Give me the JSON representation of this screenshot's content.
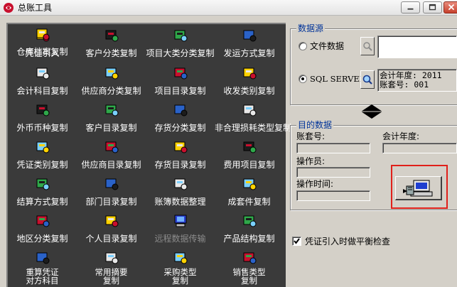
{
  "window": {
    "title": "总账工具"
  },
  "tools": [
    {
      "label": "凭证引入",
      "icon": "voucher-stamp-icon"
    },
    {
      "label": "客户分类复制",
      "icon": "customer-category-icon"
    },
    {
      "label": "项目大类分类复制",
      "icon": "project-class-icon"
    },
    {
      "label": "发运方式复制",
      "icon": "shipping-method-icon"
    },
    {
      "label": "会计科目复制",
      "icon": "account-subject-icon"
    },
    {
      "label": "供应商分类复制",
      "icon": "supplier-category-icon"
    },
    {
      "label": "项目目录复制",
      "icon": "project-catalog-icon"
    },
    {
      "label": "收发类别复制",
      "icon": "receipt-dispatch-icon"
    },
    {
      "label": "外币币种复制",
      "icon": "currency-icon"
    },
    {
      "label": "客户目录复制",
      "icon": "customer-catalog-icon"
    },
    {
      "label": "存货分类复制",
      "icon": "inventory-category-icon"
    },
    {
      "label": "非合理损耗类型复制",
      "icon": "loss-type-icon"
    },
    {
      "label": "凭证类别复制",
      "icon": "voucher-type-icon"
    },
    {
      "label": "供应商目录复制",
      "icon": "supplier-catalog-icon"
    },
    {
      "label": "存货目录复制",
      "icon": "inventory-catalog-icon"
    },
    {
      "label": "费用项目复制",
      "icon": "expense-item-icon"
    },
    {
      "label": "结算方式复制",
      "icon": "settlement-icon"
    },
    {
      "label": "部门目录复制",
      "icon": "department-icon"
    },
    {
      "label": "账簿数据整理",
      "icon": "ledger-data-icon"
    },
    {
      "label": "成套件复制",
      "icon": "kit-icon"
    },
    {
      "label": "地区分类复制",
      "icon": "region-category-icon"
    },
    {
      "label": "个人目录复制",
      "icon": "personnel-icon"
    },
    {
      "label": "远程数据传输",
      "icon": "remote-transfer-icon",
      "disabled": true
    },
    {
      "label": "产品结构复制",
      "icon": "product-structure-icon"
    },
    {
      "label": "重算凭证对方科目",
      "icon": "recalc-voucher-icon"
    },
    {
      "label": "常用摘要复制",
      "icon": "common-summary-icon"
    },
    {
      "label": "采购类型复制",
      "icon": "purchase-type-icon"
    },
    {
      "label": "销售类型复制",
      "icon": "sales-type-icon"
    },
    {
      "label": "仓库档案复制",
      "icon": "warehouse-icon"
    }
  ],
  "source": {
    "group_title": "数据源",
    "option_file": "文件数据",
    "option_sql": "SQL SERVER",
    "selected": "SQL SERVER",
    "file_path": "",
    "sql_info_year": "会计年度: 2011",
    "sql_info_account": "账套号: 001"
  },
  "target": {
    "group_title": "目的数据",
    "account_label": "账套号:",
    "year_label": "会计年度:",
    "operator_label": "操作员:",
    "time_label": "操作时间:",
    "account_value": "",
    "year_value": "",
    "operator_value": "",
    "time_value": ""
  },
  "balance_check": {
    "label": "凭证引入时做平衡检查",
    "checked": true
  }
}
